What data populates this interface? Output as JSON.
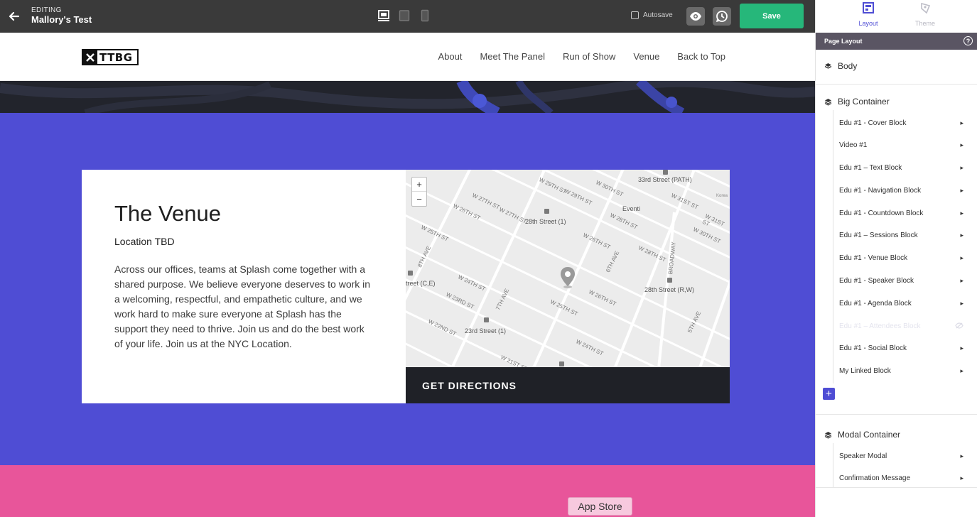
{
  "editor": {
    "editing_label": "EDITING",
    "document_title": "Mallory's Test",
    "autosave_label": "Autosave",
    "save_label": "Save"
  },
  "site": {
    "logo_text": "TTBG",
    "nav": [
      "About",
      "Meet The Panel",
      "Run of Show",
      "Venue",
      "Back to Top"
    ]
  },
  "venue": {
    "title": "The Venue",
    "subtitle": "Location TBD",
    "description": "Across our offices, teams at Splash come together with a shared purpose. We believe everyone deserves to work in a welcoming, respectful, and empathetic culture, and we work hard to make sure everyone at Splash has the support they need to thrive. Join us and do the best work of your life. Join us at the NYC Location.",
    "directions_label": "GET DIRECTIONS"
  },
  "map": {
    "zoom_in": "+",
    "zoom_out": "−",
    "labels": {
      "street_33_path": "33rd Street (PATH)",
      "street_28_1": "28th Street (1)",
      "street_28_rw": "28th Street (R,W)",
      "street_23_1": "23rd Street (1)",
      "street_ce": "treet (C,E)",
      "w29": "W 29TH ST",
      "w29b": "W 29TH ST",
      "w30": "W 30TH ST",
      "w30b": "W 30TH ST",
      "w31": "W 31ST ST",
      "w31b": "W 31ST ST",
      "w27": "W 27TH ST",
      "w27b": "W 27TH ST",
      "w28": "W 28TH ST",
      "w28b": "W 28TH ST",
      "w26": "W 26TH ST",
      "w26b": "W 26TH ST",
      "w26c": "W 26TH ST",
      "w25": "W 25TH ST",
      "w25b": "W 25TH ST",
      "w24": "W 24TH ST",
      "w24b": "W 24TH ST",
      "w23": "W 23RD ST",
      "w22": "W 22ND ST",
      "ave8": "8TH AVE",
      "ave7": "7TH AVE",
      "ave6": "6TH AVE",
      "ave5": "5TH AVE",
      "broadway": "BROADWAY",
      "eventi": "Eventi",
      "korea": "Korea",
      "w21": "W 21ST ST"
    }
  },
  "app_store_label": "App Store",
  "panel": {
    "tabs": {
      "layout": "Layout",
      "theme": "Theme"
    },
    "section_title": "Page Layout",
    "help": "?",
    "body_label": "Body",
    "big_container": {
      "label": "Big Container",
      "items": [
        "Edu #1 - Cover Block",
        "Video #1",
        "Edu #1 – Text Block",
        "Edu #1 - Navigation Block",
        "Edu #1 - Countdown Block",
        "Edu #1 – Sessions Block",
        "Edu #1 - Venue Block",
        "Edu #1 - Speaker Block",
        "Edu #1 - Agenda Block",
        "Edu #1 – Attendees Block",
        "Edu #1 - Social Block",
        "My Linked Block"
      ]
    },
    "add_label": "+",
    "modal_container": {
      "label": "Modal Container",
      "items": [
        "Speaker Modal",
        "Confirmation Message"
      ]
    }
  },
  "colors": {
    "accent_purple": "#4f4dd4",
    "save_green": "#26b77a",
    "pink": "#e8559a",
    "dark": "#1f2127"
  }
}
